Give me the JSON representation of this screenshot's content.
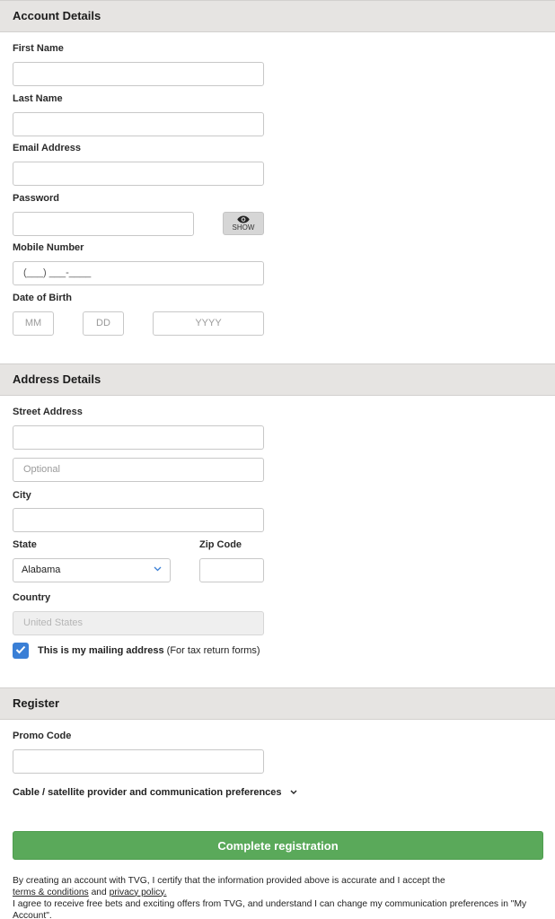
{
  "account": {
    "header": "Account Details",
    "first_name_label": "First Name",
    "last_name_label": "Last Name",
    "email_label": "Email Address",
    "password_label": "Password",
    "show_label": "SHOW",
    "mobile_label": "Mobile Number",
    "mobile_placeholder": "(___) ___-____",
    "dob_label": "Date of Birth",
    "dob_mm": "MM",
    "dob_dd": "DD",
    "dob_yyyy": "YYYY"
  },
  "address": {
    "header": "Address Details",
    "street_label": "Street Address",
    "street2_placeholder": "Optional",
    "city_label": "City",
    "state_label": "State",
    "state_value": "Alabama",
    "zip_label": "Zip Code",
    "country_label": "Country",
    "country_value": "United States",
    "mailing_bold": "This is my mailing address",
    "mailing_note": " (For tax return forms)"
  },
  "register": {
    "header": "Register",
    "promo_label": "Promo Code",
    "cable_label": "Cable / satellite provider and communication preferences",
    "complete_label": "Complete registration",
    "legal_1a": "By creating an account with TVG, I certify that the information provided above is accurate and I accept the",
    "terms_link": "terms & conditions",
    "and_text": " and ",
    "privacy_link": "privacy policy.",
    "legal_2": "I agree to receive free bets and exciting offers from TVG, and understand I can change my communication preferences in \"My Account\"."
  },
  "colors": {
    "section_bg": "#e6e4e2",
    "button_green": "#5aa95a",
    "checkbox_blue": "#3a7fd6"
  }
}
